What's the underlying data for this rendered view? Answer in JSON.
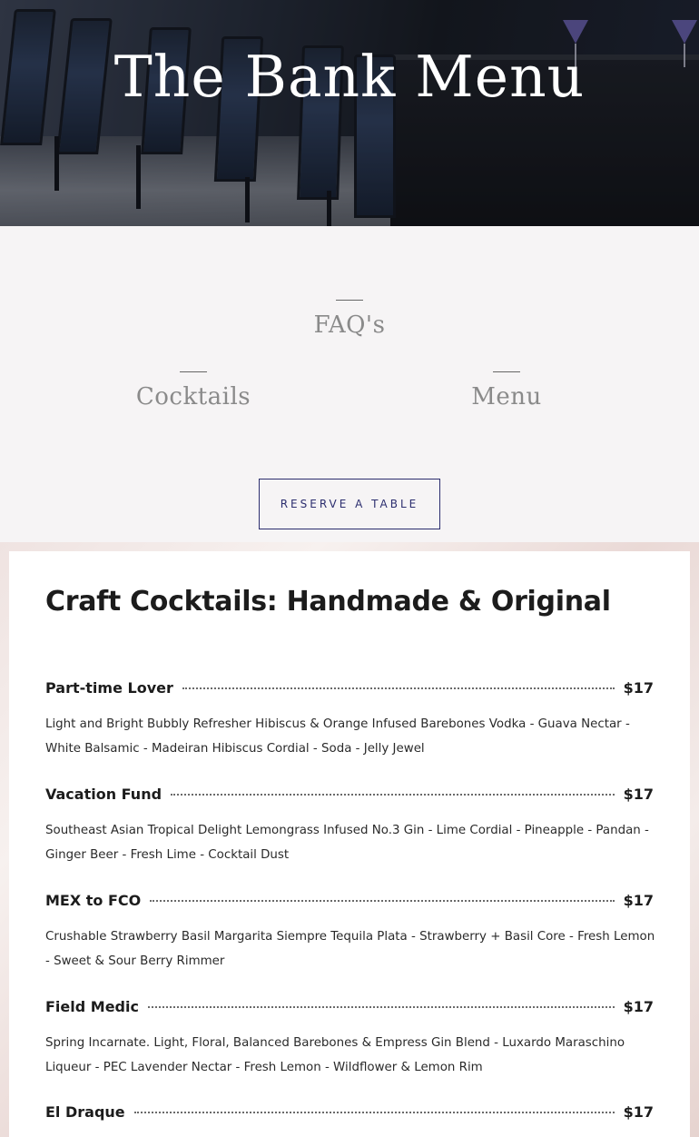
{
  "hero": {
    "title": "The Bank Menu"
  },
  "nav": {
    "links": [
      {
        "label": "FAQ's"
      },
      {
        "label": "Cocktails"
      },
      {
        "label": "Menu"
      }
    ],
    "reserve_label": "RESERVE A TABLE"
  },
  "menu": {
    "heading": "Craft Cocktails: Handmade & Original",
    "items": [
      {
        "name": "Part-time Lover",
        "price": "$17",
        "description": "Light and Bright Bubbly Refresher Hibiscus & Orange Infused Barebones Vodka - Guava Nectar - White Balsamic - Madeiran Hibiscus Cordial - Soda - Jelly Jewel"
      },
      {
        "name": "Vacation Fund",
        "price": "$17",
        "description": "Southeast Asian Tropical Delight Lemongrass Infused No.3 Gin - Lime Cordial - Pineapple - Pandan - Ginger Beer - Fresh Lime - Cocktail Dust"
      },
      {
        "name": "MEX to FCO",
        "price": "$17",
        "description": "Crushable Strawberry Basil Margarita Siempre Tequila Plata - Strawberry + Basil Core - Fresh Lemon - Sweet & Sour Berry Rimmer"
      },
      {
        "name": "Field Medic",
        "price": "$17",
        "description": "Spring Incarnate. Light, Floral, Balanced Barebones & Empress Gin Blend - Luxardo Maraschino Liqueur - PEC Lavender Nectar - Fresh Lemon - Wildflower & Lemon Rim"
      },
      {
        "name": "El Draque",
        "price": "$17",
        "description": ""
      }
    ]
  },
  "colors": {
    "accent": "#2b2d6e",
    "nav_text": "#8a8a8a",
    "heading_text": "#1c1c1c"
  }
}
